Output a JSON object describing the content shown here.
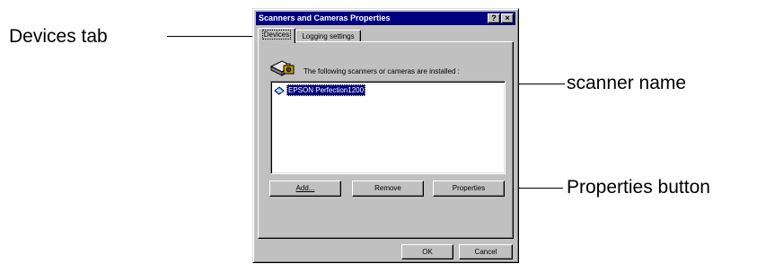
{
  "callouts": {
    "devices_tab": "Devices tab",
    "scanner_name": "scanner name",
    "properties_button": "Properties button"
  },
  "dialog": {
    "title": "Scanners and Cameras Properties",
    "help_button": "?",
    "close_button": "×",
    "tabs": [
      {
        "label": "Devices",
        "active": true
      },
      {
        "label": "Logging settings",
        "active": false
      }
    ],
    "info_text": "The following scanners or cameras are installed :",
    "devices": [
      {
        "name": "EPSON Perfection1200",
        "selected": true,
        "icon": "scanner-icon"
      }
    ],
    "buttons": {
      "add": "Add...",
      "remove": "Remove",
      "properties": "Properties"
    },
    "ok": "OK",
    "cancel": "Cancel"
  }
}
